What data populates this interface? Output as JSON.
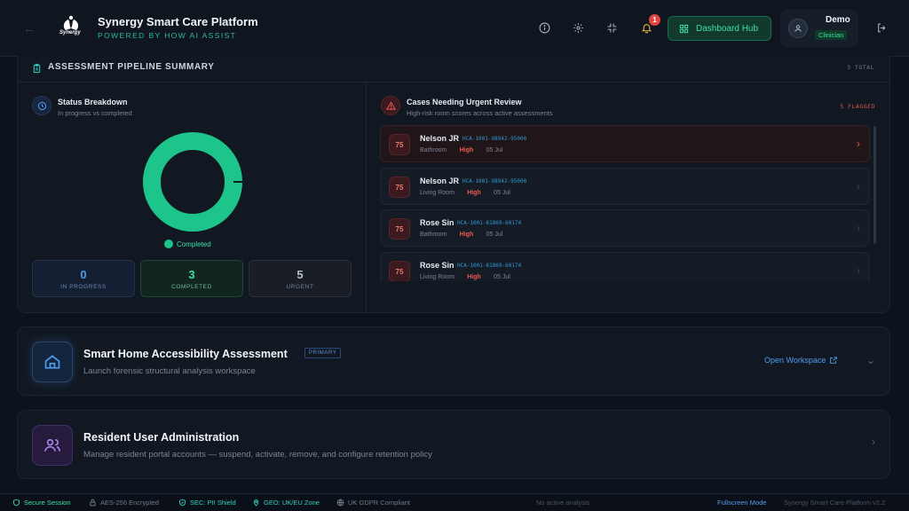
{
  "header": {
    "logo_text": "Synergy",
    "title": "Synergy Smart Care Platform",
    "subtitle": "POWERED BY HOW AI ASSIST",
    "notification_count": "1",
    "hub_button": "Dashboard Hub",
    "user_name": "Demo",
    "user_role": "Clinician"
  },
  "pipeline": {
    "title": "ASSESSMENT PIPELINE SUMMARY",
    "total": "3 TOTAL",
    "status": {
      "title": "Status Breakdown",
      "subtitle": "In progress vs completed",
      "legend": "Completed",
      "completed_fraction": 1.0,
      "stats": [
        {
          "value": "0",
          "label": "IN PROGRESS"
        },
        {
          "value": "3",
          "label": "COMPLETED"
        },
        {
          "value": "5",
          "label": "URGENT"
        }
      ]
    },
    "urgent": {
      "title": "Cases Needing Urgent Review",
      "subtitle": "High-risk room scores across active assessments",
      "flagged": "5 FLAGGED",
      "cases": [
        {
          "score": "75",
          "name": "Nelson JR",
          "id": "HCA-1001-98942-95000",
          "room": "Bathroom",
          "severity": "High",
          "date": "05 Jul"
        },
        {
          "score": "75",
          "name": "Nelson JR",
          "id": "HCA-1001-98942-95000",
          "room": "Living Room",
          "severity": "High",
          "date": "05 Jul"
        },
        {
          "score": "75",
          "name": "Rose Sin",
          "id": "HCA-1001-61869-60174",
          "room": "Bathroom",
          "severity": "High",
          "date": "05 Jul"
        },
        {
          "score": "75",
          "name": "Rose Sin",
          "id": "HCA-1001-61869-60174",
          "room": "Living Room",
          "severity": "High",
          "date": "05 Jul"
        }
      ]
    }
  },
  "modules": [
    {
      "title": "Smart Home Accessibility Assessment",
      "badge": "PRIMARY",
      "subtitle": "Launch forensic structural analysis workspace",
      "action": "Open Workspace"
    },
    {
      "title": "Resident User Administration",
      "subtitle": "Manage resident portal accounts — suspend, activate, remove, and configure retention policy"
    }
  ],
  "footer": {
    "secure": "Secure Session",
    "encryption": "AES-256 Encrypted",
    "sec": "SEC: PII Shield",
    "geo": "GEO: UK/EU Zone",
    "gdpr": "UK GDPR Compliant",
    "analysis": "No active analysis",
    "fullscreen": "Fullscreen Mode",
    "version": "Synergy Smart Care Platform v2.2"
  },
  "colors": {
    "accent": "#3ee0a2",
    "danger": "#ef5a52",
    "link": "#4e9df2"
  }
}
